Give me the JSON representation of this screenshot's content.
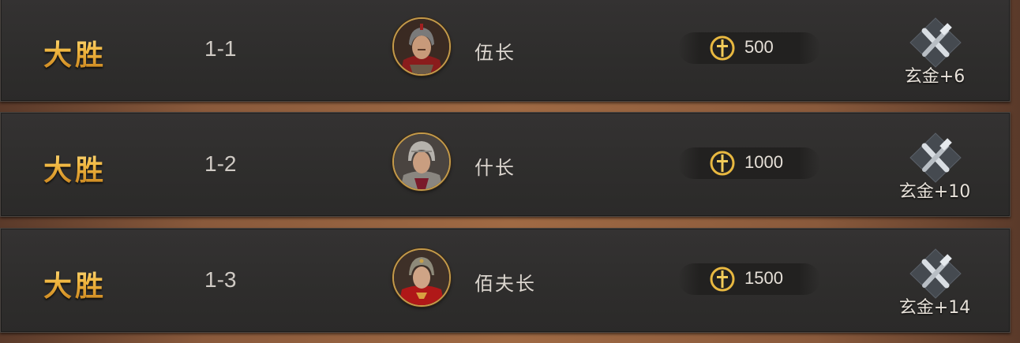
{
  "records": [
    {
      "result": "大胜",
      "stage": "1-1",
      "rank": "伍长",
      "coins": "500",
      "reward": "玄金+6",
      "portrait": "soldier-red-helmet"
    },
    {
      "result": "大胜",
      "stage": "1-2",
      "rank": "什长",
      "coins": "1000",
      "reward": "玄金+10",
      "portrait": "soldier-silver-helmet"
    },
    {
      "result": "大胜",
      "stage": "1-3",
      "rank": "佰夫长",
      "coins": "1500",
      "reward": "玄金+14",
      "portrait": "soldier-red-robe"
    }
  ],
  "icons": {
    "coin": "sword-coin-icon",
    "reward": "crossed-tools-icon"
  },
  "colors": {
    "gold": "#e0a732",
    "panel": "#2f2e2d",
    "frame": "#a06a44",
    "portrait_border": "#c49a4a"
  }
}
